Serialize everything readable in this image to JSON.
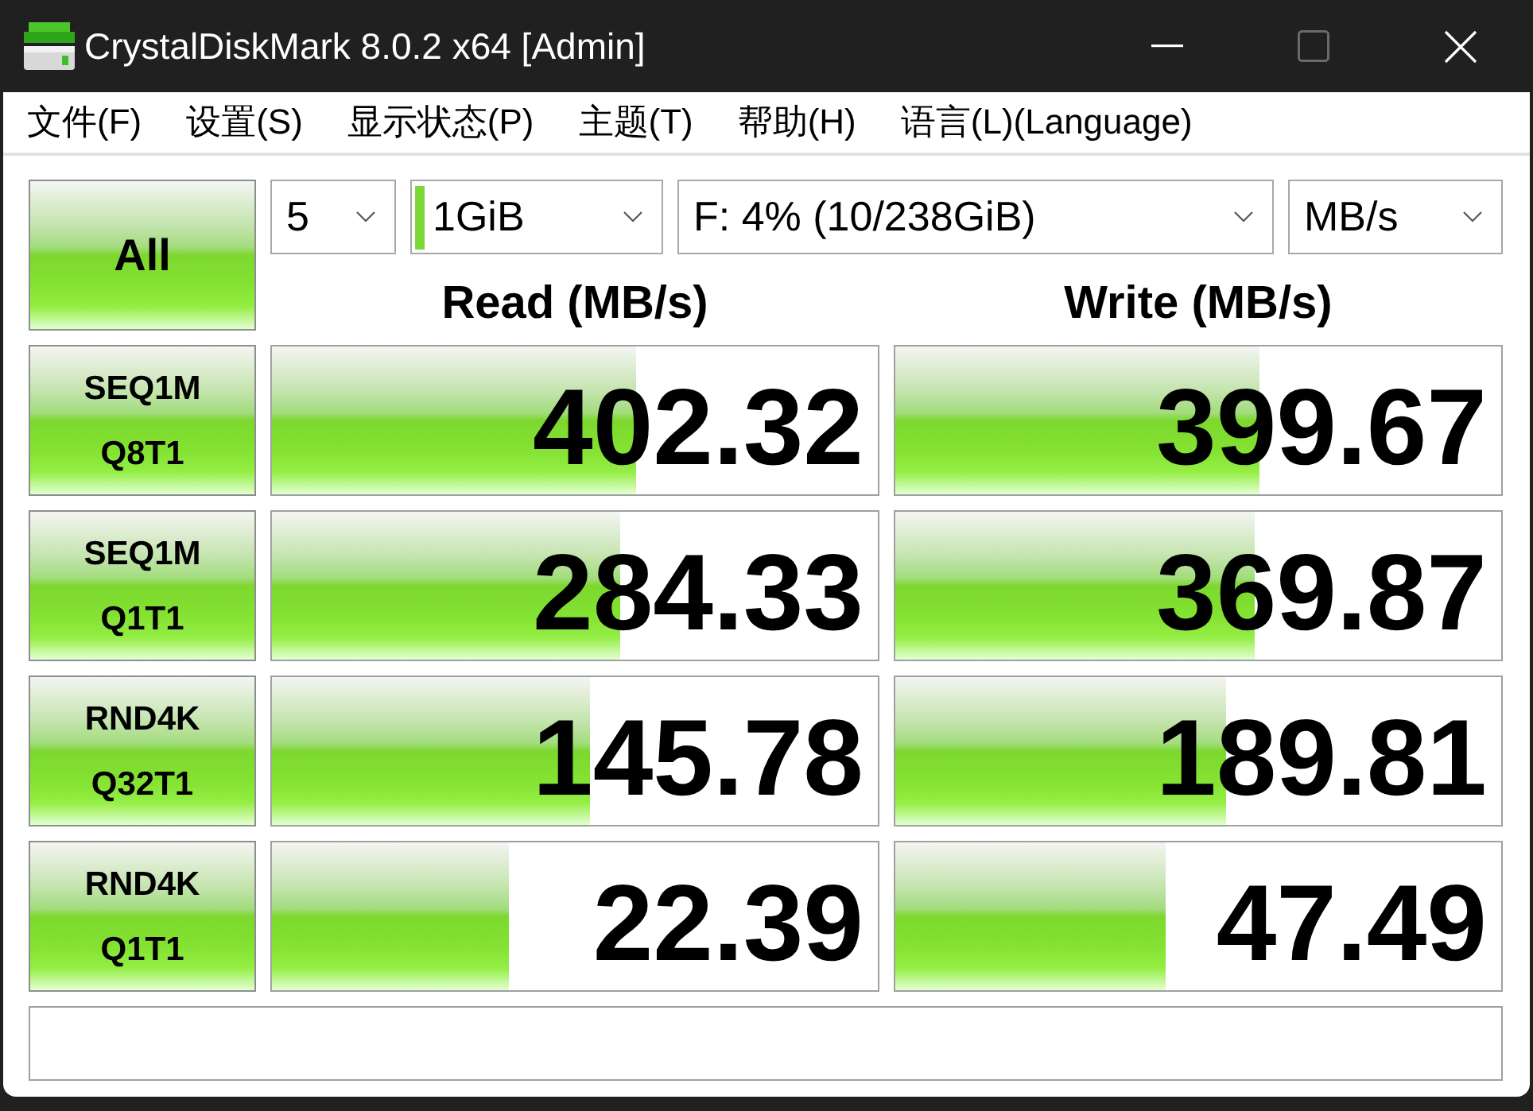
{
  "window": {
    "title": "CrystalDiskMark 8.0.2 x64 [Admin]"
  },
  "menu": [
    "文件(F)",
    "设置(S)",
    "显示状态(P)",
    "主题(T)",
    "帮助(H)",
    "语言(L)(Language)"
  ],
  "all_button": "All",
  "dropdowns": [
    {
      "kind": "plain",
      "value": "5"
    },
    {
      "kind": "indicator",
      "value": "1GiB"
    },
    {
      "kind": "plain",
      "value": "F: 4% (10/238GiB)"
    },
    {
      "kind": "plain",
      "value": "MB/s"
    }
  ],
  "headers": [
    "Read (MB/s)",
    "Write (MB/s)"
  ],
  "tests": [
    {
      "name": "SEQ1M",
      "params": "Q8T1",
      "read": {
        "value": "402.32",
        "level": 0.6
      },
      "write": {
        "value": "399.67",
        "level": 0.6
      }
    },
    {
      "name": "SEQ1M",
      "params": "Q1T1",
      "read": {
        "value": "284.33",
        "level": 0.576
      },
      "write": {
        "value": "369.87",
        "level": 0.594
      }
    },
    {
      "name": "RND4K",
      "params": "Q32T1",
      "read": {
        "value": "145.78",
        "level": 0.526
      },
      "write": {
        "value": "189.81",
        "level": 0.545
      }
    },
    {
      "name": "RND4K",
      "params": "Q1T1",
      "read": {
        "value": "22.39",
        "level": 0.39
      },
      "write": {
        "value": "47.49",
        "level": 0.445
      }
    }
  ]
}
